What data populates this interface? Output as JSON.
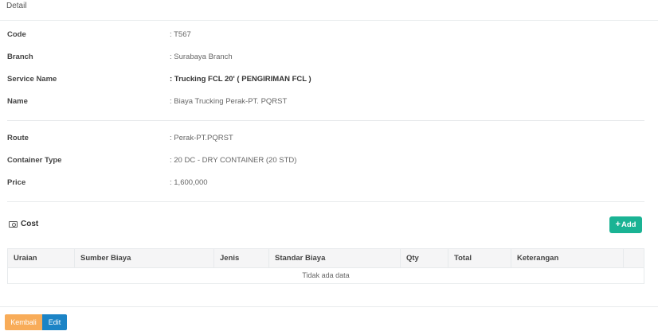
{
  "panel": {
    "title": "Detail"
  },
  "details": {
    "code": {
      "label": "Code",
      "value": ": T567"
    },
    "branch": {
      "label": "Branch",
      "value": ": Surabaya Branch"
    },
    "service_name": {
      "label": "Service Name",
      "value": ": Trucking FCL 20' ( PENGIRIMAN FCL )"
    },
    "name": {
      "label": "Name",
      "value": ": Biaya Trucking Perak-PT. PQRST"
    },
    "route": {
      "label": "Route",
      "value": ": Perak-PT.PQRST"
    },
    "container_type": {
      "label": "Container Type",
      "value": ": 20 DC - DRY CONTAINER (20 STD)"
    },
    "price": {
      "label": "Price",
      "value": ": 1,600,000"
    }
  },
  "cost": {
    "title": "Cost",
    "icon": "money-icon",
    "add_label": "Add",
    "add_icon": "plus-icon",
    "columns": [
      "Uraian",
      "Sumber Biaya",
      "Jenis",
      "Standar Biaya",
      "Qty",
      "Total",
      "Keterangan",
      ""
    ],
    "empty_text": "Tidak ada data"
  },
  "actions": {
    "back_label": "Kembali",
    "edit_label": "Edit"
  },
  "colors": {
    "add": "#1ab394",
    "back": "#f8ac59",
    "edit": "#1c84c6"
  }
}
